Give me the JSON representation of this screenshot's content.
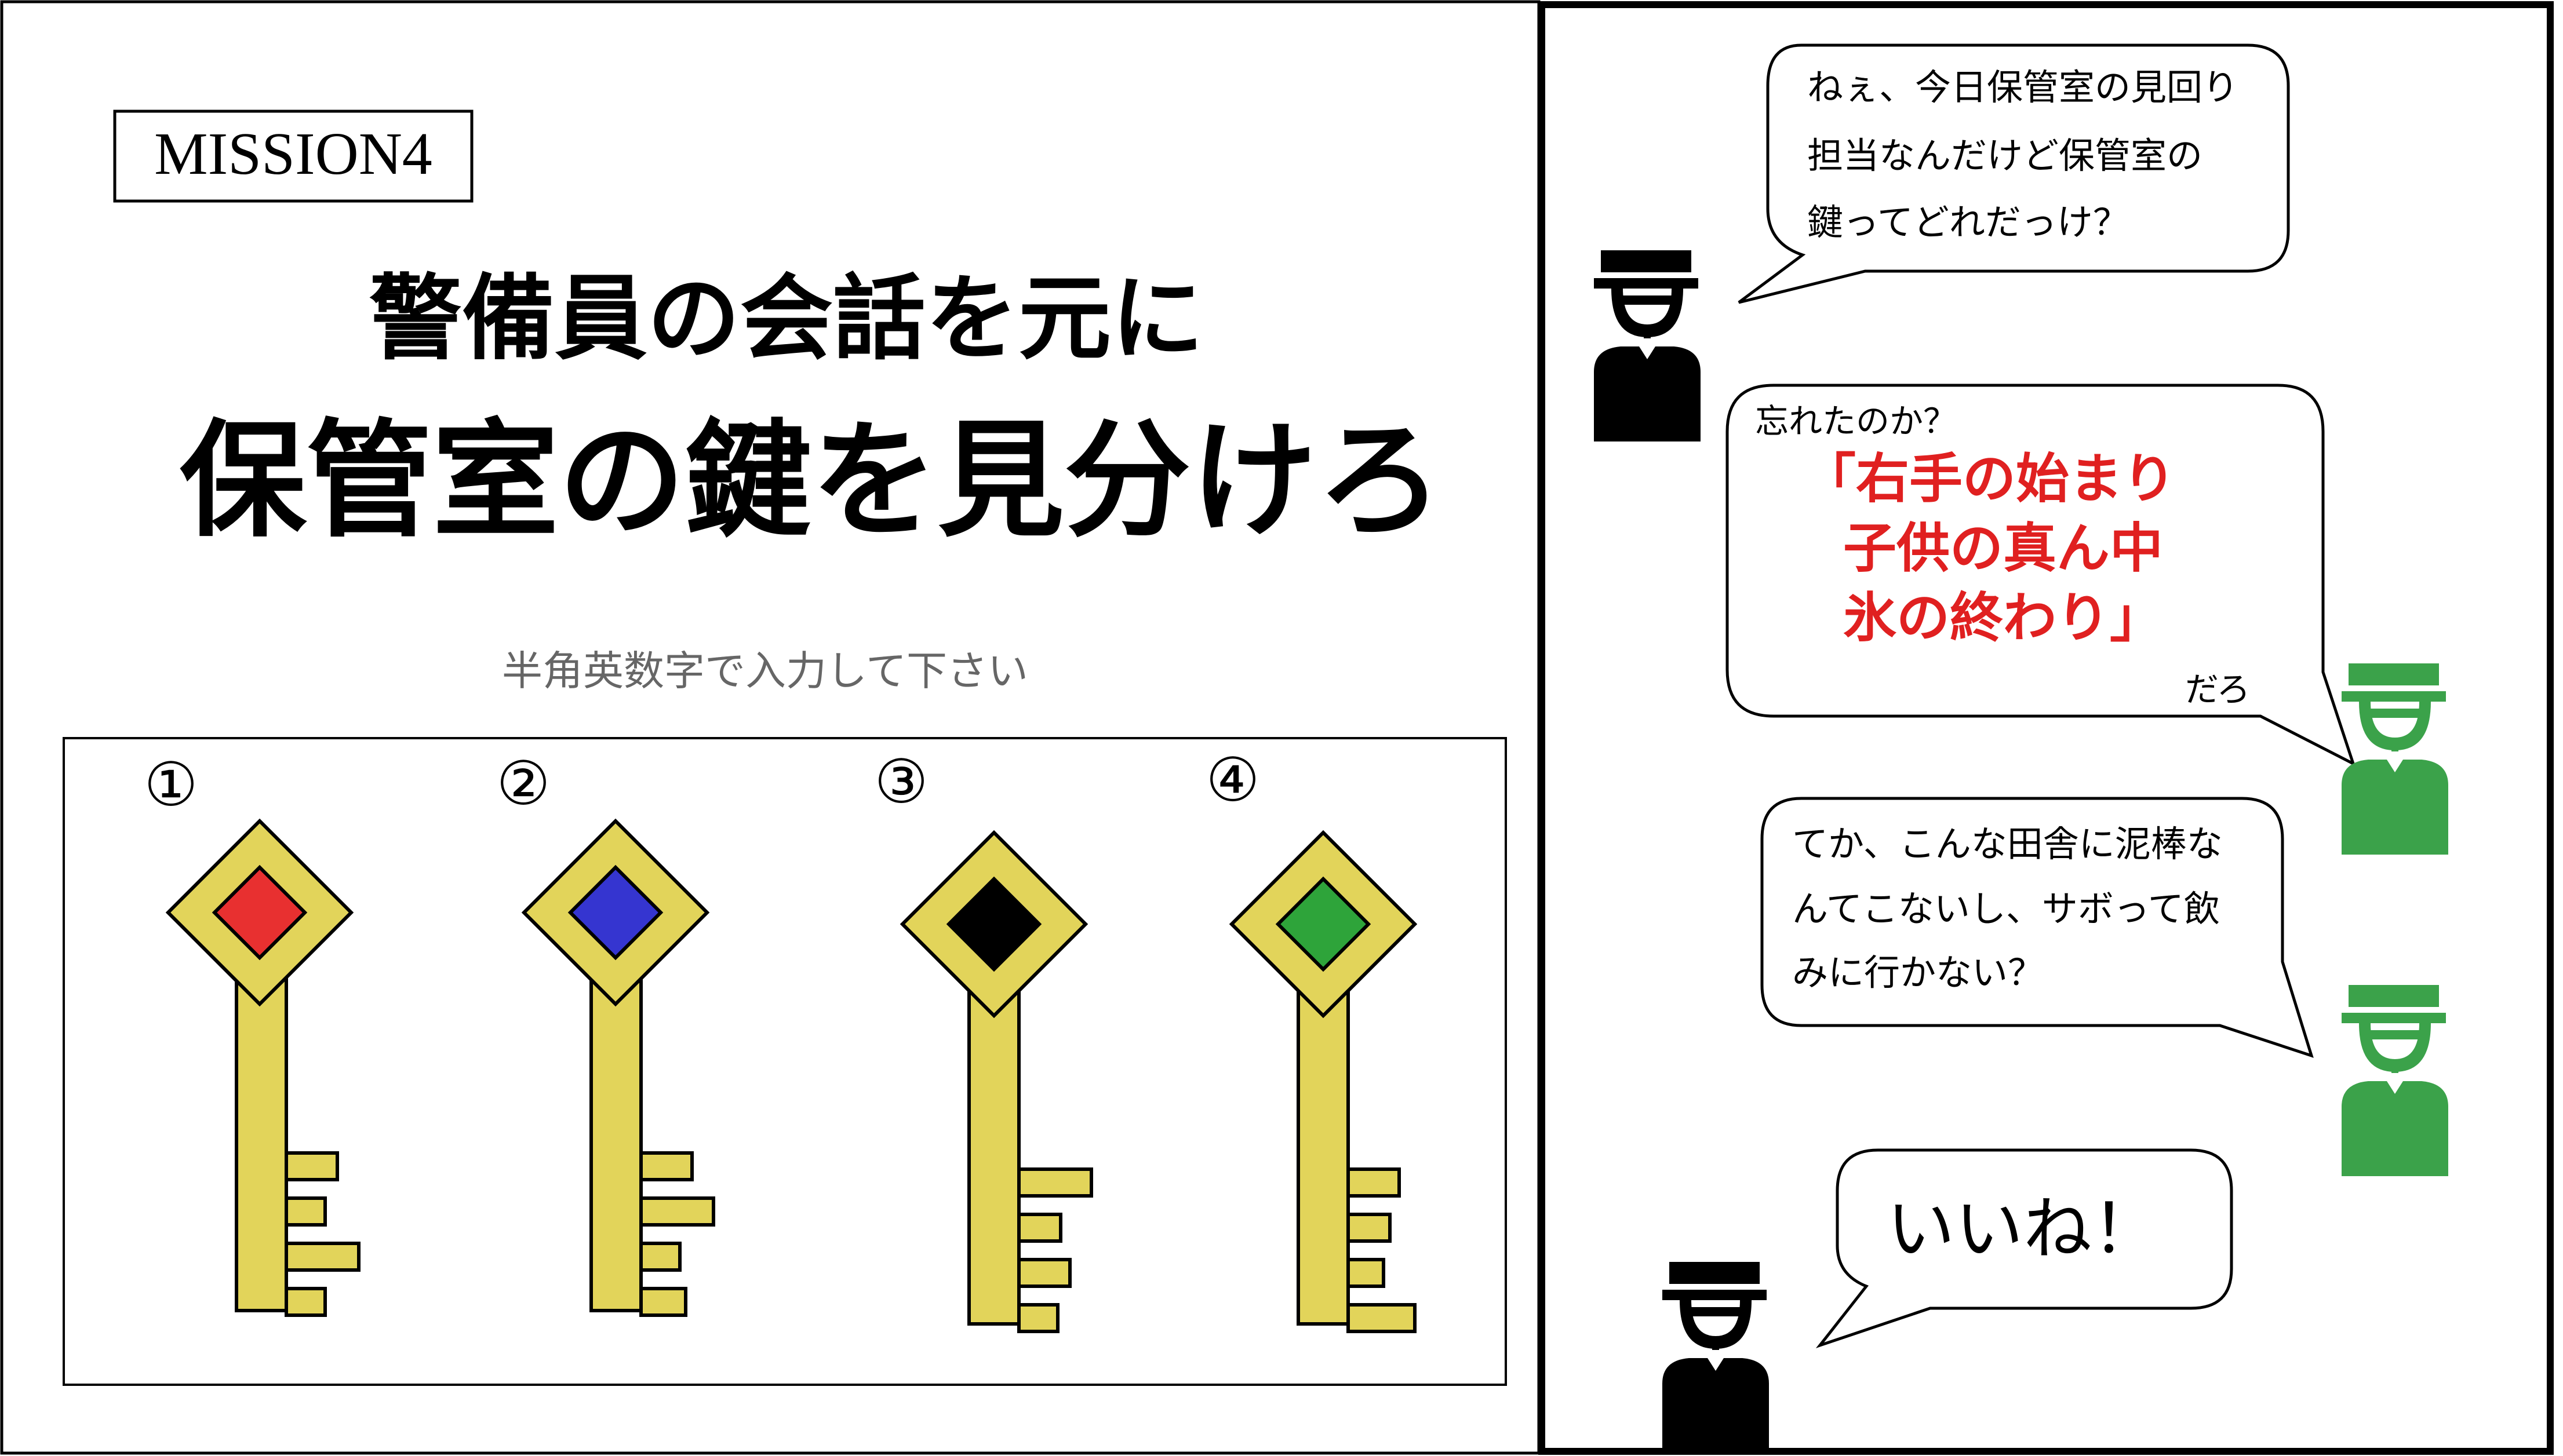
{
  "left_panel": {
    "mission_label": "MISSION4",
    "title_line1": "警備員の会話を元に",
    "title_line2": "保管室の鍵を見分けろ",
    "instruction": "半角英数字で入力して下さい"
  },
  "keys": [
    {
      "number": "①",
      "gem_color": "#e83030",
      "teeth": [
        0.55,
        0.42,
        0.78,
        0.42
      ]
    },
    {
      "number": "②",
      "gem_color": "#3535d0",
      "teeth": [
        0.55,
        0.78,
        0.42,
        0.48
      ]
    },
    {
      "number": "③",
      "gem_color": "#000000",
      "teeth": [
        0.78,
        0.45,
        0.55,
        0.42
      ]
    },
    {
      "number": "④",
      "gem_color": "#2ea43a",
      "teeth": [
        0.55,
        0.45,
        0.38,
        0.72
      ]
    }
  ],
  "dialogue": [
    {
      "speaker": "black",
      "lines": [
        "ねぇ、今日保管室の見回り",
        "担当なんだけど保管室の",
        "鍵ってどれだっけ？"
      ]
    },
    {
      "speaker": "green",
      "intro": "忘れたのか？",
      "hint_lines": [
        "「右手の始まり",
        "子供の真ん中",
        "氷の終わり」"
      ],
      "outro": "だろ"
    },
    {
      "speaker": "green",
      "lines": [
        "てか、こんな田舎に泥棒な",
        "んてこないし、サボって飲",
        "みに行かない？"
      ]
    },
    {
      "speaker": "black",
      "lines": [
        "いいね！"
      ]
    }
  ],
  "colors": {
    "key_gold": "#e2d45a",
    "guard_black": "#000000",
    "guard_green": "#3ba24a",
    "hint_red": "#e02020"
  }
}
